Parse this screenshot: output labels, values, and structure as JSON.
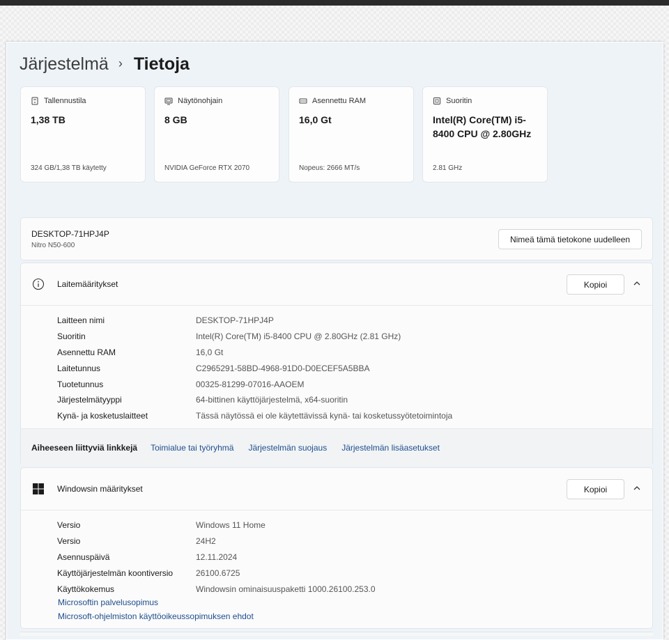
{
  "breadcrumb": {
    "parent": "Järjestelmä",
    "separator": "›",
    "current": "Tietoja"
  },
  "spec_cards": [
    {
      "icon": "storage-icon",
      "label": "Tallennustila",
      "value": "1,38 TB",
      "sub": "324 GB/1,38 TB käytetty"
    },
    {
      "icon": "gpu-icon",
      "label": "Näytönohjain",
      "value": "8 GB",
      "sub": "NVIDIA GeForce RTX 2070"
    },
    {
      "icon": "ram-icon",
      "label": "Asennettu RAM",
      "value": "16,0 Gt",
      "sub": "Nopeus: 2666 MT/s"
    },
    {
      "icon": "cpu-icon",
      "label": "Suoritin",
      "value": "Intel(R) Core(TM) i5-8400 CPU @ 2.80GHz",
      "sub": "2.81 GHz"
    }
  ],
  "device": {
    "name": "DESKTOP-71HPJ4P",
    "model": "Nitro N50-600",
    "rename_label": "Nimeä tämä tietokone uudelleen"
  },
  "device_specs": {
    "title": "Laitemääritykset",
    "copy_label": "Kopioi",
    "rows": [
      {
        "key": "Laitteen nimi",
        "value": "DESKTOP-71HPJ4P"
      },
      {
        "key": "Suoritin",
        "value": "Intel(R) Core(TM) i5-8400 CPU @ 2.80GHz (2.81 GHz)"
      },
      {
        "key": "Asennettu RAM",
        "value": "16,0 Gt"
      },
      {
        "key": "Laitetunnus",
        "value": "C2965291-58BD-4968-91D0-D0ECEF5A5BBA"
      },
      {
        "key": "Tuotetunnus",
        "value": "00325-81299-07016-AAOEM"
      },
      {
        "key": "Järjestelmätyyppi",
        "value": "64-bittinen käyttöjärjestelmä, x64-suoritin"
      },
      {
        "key": "Kynä- ja kosketuslaitteet",
        "value": "Tässä näytössä ei ole käytettävissä kynä- tai kosketussyötetoimintoja"
      }
    ],
    "related_label": "Aiheeseen liittyviä linkkejä",
    "related_links": [
      "Toimialue tai työryhmä",
      "Järjestelmän suojaus",
      "Järjestelmän lisäasetukset"
    ]
  },
  "windows_specs": {
    "title": "Windowsin määritykset",
    "copy_label": "Kopioi",
    "rows": [
      {
        "key": "Versio",
        "value": "Windows 11 Home"
      },
      {
        "key": "Versio",
        "value": "24H2"
      },
      {
        "key": "Asennuspäivä",
        "value": "12.11.2024"
      },
      {
        "key": "Käyttöjärjestelmän koontiversio",
        "value": "26100.6725"
      },
      {
        "key": "Käyttökokemus",
        "value": "Windowsin ominaisuuspaketti 1000.26100.253.0"
      }
    ],
    "links": [
      "Microsoftin palvelusopimus",
      "Microsoft-ohjelmiston käyttöoikeussopimuksen ehdot"
    ]
  },
  "colors": {
    "link": "#1f4e8c",
    "window_bg": "#eef3f8",
    "card_bg": "#fdfdfd"
  }
}
